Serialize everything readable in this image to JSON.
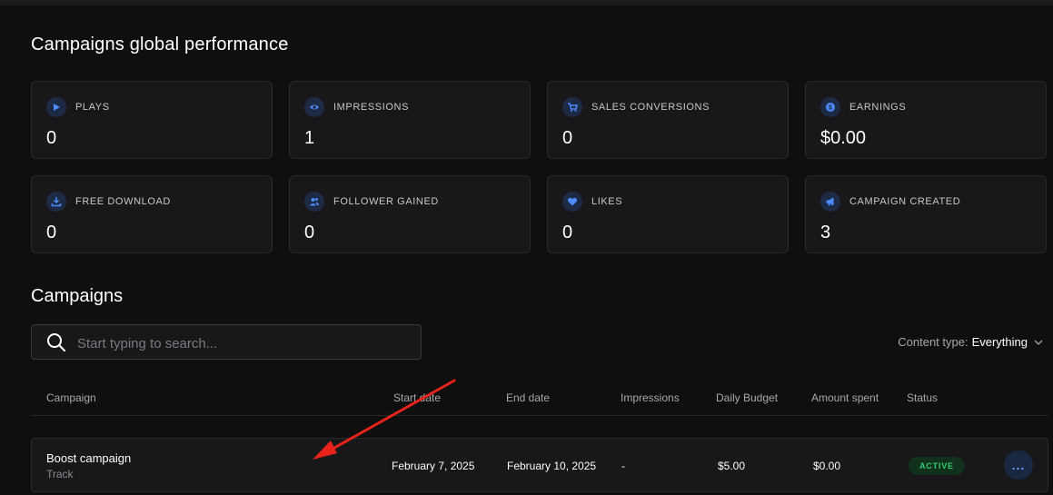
{
  "page": {
    "title": "Campaigns global performance"
  },
  "stats": [
    {
      "label": "PLAYS",
      "value": "0",
      "icon": "play-icon"
    },
    {
      "label": "IMPRESSIONS",
      "value": "1",
      "icon": "eye-icon"
    },
    {
      "label": "SALES CONVERSIONS",
      "value": "0",
      "icon": "cart-icon"
    },
    {
      "label": "EARNINGS",
      "value": "$0.00",
      "icon": "dollar-icon"
    },
    {
      "label": "FREE DOWNLOAD",
      "value": "0",
      "icon": "download-icon"
    },
    {
      "label": "FOLLOWER GAINED",
      "value": "0",
      "icon": "users-icon"
    },
    {
      "label": "LIKES",
      "value": "0",
      "icon": "heart-icon"
    },
    {
      "label": "CAMPAIGN CREATED",
      "value": "3",
      "icon": "megaphone-icon"
    }
  ],
  "campaigns": {
    "title": "Campaigns",
    "search": {
      "placeholder": "Start typing to search...",
      "value": ""
    },
    "content_type": {
      "label": "Content type:",
      "value": "Everything"
    },
    "columns": [
      "Campaign",
      "Start date",
      "End date",
      "Impressions",
      "Daily Budget",
      "Amount spent",
      "Status"
    ],
    "rows": [
      {
        "name": "Boost campaign",
        "type": "Track",
        "start_date": "February 7, 2025",
        "end_date": "February 10, 2025",
        "impressions": "-",
        "daily_budget": "$5.00",
        "amount_spent": "$0.00",
        "status": "ACTIVE",
        "more": "..."
      }
    ]
  },
  "colors": {
    "background": "#0f0f10",
    "card": "#18181a",
    "accent": "#3b82f6",
    "status_active": "#2ecc71",
    "annotation_arrow": "#e8231c"
  }
}
